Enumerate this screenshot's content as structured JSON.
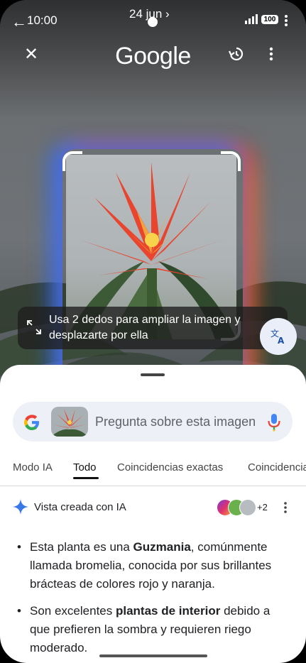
{
  "status_bar": {
    "back_glyph": "←",
    "time": "10:00",
    "date": "24 jun ›",
    "battery": "100"
  },
  "toolbar": {
    "logo": "Google"
  },
  "hint": {
    "text": "Usa 2 dedos para ampliar la imagen y desplazarte por ella"
  },
  "search": {
    "placeholder": "Pregunta sobre esta imagen"
  },
  "tabs": [
    {
      "label": "Modo IA"
    },
    {
      "label": "Todo",
      "active": true
    },
    {
      "label": "Coincidencias exactas"
    },
    {
      "label": "Coincidencias"
    }
  ],
  "ai_overview": {
    "label": "Vista creada con IA",
    "sources_more": "+2",
    "bullets": [
      {
        "before": "Esta planta es una ",
        "bold": "Guzmania",
        "after": ", comúnmente llamada bromelia, conocida por sus brillantes brácteas de colores rojo y naranja."
      },
      {
        "before": "Son excelentes ",
        "bold": "plantas de interior",
        "after": " debido a que prefieren la sombra y requieren riego moderado."
      }
    ]
  },
  "colors": {
    "accent": "#1a73e8",
    "sheet_bg": "#ffffff",
    "search_bg": "#edf1f7"
  }
}
